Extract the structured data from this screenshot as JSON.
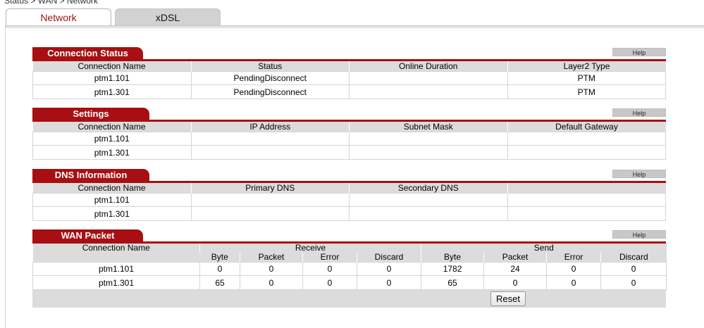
{
  "breadcrumb": "Status > WAN > Network",
  "tabs": [
    {
      "label": "Network",
      "active": true
    },
    {
      "label": "xDSL",
      "active": false
    }
  ],
  "help_label": "Help",
  "colors": {
    "accent": "#a70f13",
    "header_bg": "#dcdcdc"
  },
  "connection_status": {
    "title": "Connection Status",
    "columns": [
      "Connection Name",
      "Status",
      "Online Duration",
      "Layer2 Type"
    ],
    "rows": [
      [
        "ptm1.101",
        "PendingDisconnect",
        "",
        "PTM"
      ],
      [
        "ptm1.301",
        "PendingDisconnect",
        "",
        "PTM"
      ]
    ]
  },
  "settings": {
    "title": "Settings",
    "columns": [
      "Connection Name",
      "IP Address",
      "Subnet Mask",
      "Default Gateway"
    ],
    "rows": [
      [
        "ptm1.101",
        "",
        "",
        ""
      ],
      [
        "ptm1.301",
        "",
        "",
        ""
      ]
    ]
  },
  "dns": {
    "title": "DNS Information",
    "columns": [
      "Connection Name",
      "Primary DNS",
      "Secondary DNS",
      ""
    ],
    "rows": [
      [
        "ptm1.101",
        "",
        "",
        ""
      ],
      [
        "ptm1.301",
        "",
        "",
        ""
      ]
    ]
  },
  "wan_packet": {
    "title": "WAN Packet",
    "name_col": "Connection Name",
    "receive_label": "Receive",
    "send_label": "Send",
    "sub_columns": [
      "Byte",
      "Packet",
      "Error",
      "Discard",
      "Byte",
      "Packet",
      "Error",
      "Discard"
    ],
    "rows": [
      [
        "ptm1.101",
        "0",
        "0",
        "0",
        "0",
        "1782",
        "24",
        "0",
        "0"
      ],
      [
        "ptm1.301",
        "65",
        "0",
        "0",
        "0",
        "65",
        "0",
        "0",
        "0"
      ]
    ],
    "reset_label": "Reset"
  }
}
